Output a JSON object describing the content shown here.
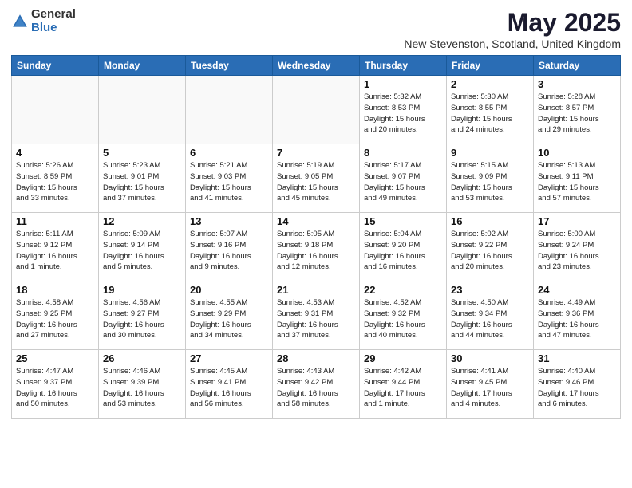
{
  "logo": {
    "general": "General",
    "blue": "Blue"
  },
  "title": "May 2025",
  "subtitle": "New Stevenston, Scotland, United Kingdom",
  "headers": [
    "Sunday",
    "Monday",
    "Tuesday",
    "Wednesday",
    "Thursday",
    "Friday",
    "Saturday"
  ],
  "weeks": [
    [
      {
        "day": "",
        "info": ""
      },
      {
        "day": "",
        "info": ""
      },
      {
        "day": "",
        "info": ""
      },
      {
        "day": "",
        "info": ""
      },
      {
        "day": "1",
        "info": "Sunrise: 5:32 AM\nSunset: 8:53 PM\nDaylight: 15 hours\nand 20 minutes."
      },
      {
        "day": "2",
        "info": "Sunrise: 5:30 AM\nSunset: 8:55 PM\nDaylight: 15 hours\nand 24 minutes."
      },
      {
        "day": "3",
        "info": "Sunrise: 5:28 AM\nSunset: 8:57 PM\nDaylight: 15 hours\nand 29 minutes."
      }
    ],
    [
      {
        "day": "4",
        "info": "Sunrise: 5:26 AM\nSunset: 8:59 PM\nDaylight: 15 hours\nand 33 minutes."
      },
      {
        "day": "5",
        "info": "Sunrise: 5:23 AM\nSunset: 9:01 PM\nDaylight: 15 hours\nand 37 minutes."
      },
      {
        "day": "6",
        "info": "Sunrise: 5:21 AM\nSunset: 9:03 PM\nDaylight: 15 hours\nand 41 minutes."
      },
      {
        "day": "7",
        "info": "Sunrise: 5:19 AM\nSunset: 9:05 PM\nDaylight: 15 hours\nand 45 minutes."
      },
      {
        "day": "8",
        "info": "Sunrise: 5:17 AM\nSunset: 9:07 PM\nDaylight: 15 hours\nand 49 minutes."
      },
      {
        "day": "9",
        "info": "Sunrise: 5:15 AM\nSunset: 9:09 PM\nDaylight: 15 hours\nand 53 minutes."
      },
      {
        "day": "10",
        "info": "Sunrise: 5:13 AM\nSunset: 9:11 PM\nDaylight: 15 hours\nand 57 minutes."
      }
    ],
    [
      {
        "day": "11",
        "info": "Sunrise: 5:11 AM\nSunset: 9:12 PM\nDaylight: 16 hours\nand 1 minute."
      },
      {
        "day": "12",
        "info": "Sunrise: 5:09 AM\nSunset: 9:14 PM\nDaylight: 16 hours\nand 5 minutes."
      },
      {
        "day": "13",
        "info": "Sunrise: 5:07 AM\nSunset: 9:16 PM\nDaylight: 16 hours\nand 9 minutes."
      },
      {
        "day": "14",
        "info": "Sunrise: 5:05 AM\nSunset: 9:18 PM\nDaylight: 16 hours\nand 12 minutes."
      },
      {
        "day": "15",
        "info": "Sunrise: 5:04 AM\nSunset: 9:20 PM\nDaylight: 16 hours\nand 16 minutes."
      },
      {
        "day": "16",
        "info": "Sunrise: 5:02 AM\nSunset: 9:22 PM\nDaylight: 16 hours\nand 20 minutes."
      },
      {
        "day": "17",
        "info": "Sunrise: 5:00 AM\nSunset: 9:24 PM\nDaylight: 16 hours\nand 23 minutes."
      }
    ],
    [
      {
        "day": "18",
        "info": "Sunrise: 4:58 AM\nSunset: 9:25 PM\nDaylight: 16 hours\nand 27 minutes."
      },
      {
        "day": "19",
        "info": "Sunrise: 4:56 AM\nSunset: 9:27 PM\nDaylight: 16 hours\nand 30 minutes."
      },
      {
        "day": "20",
        "info": "Sunrise: 4:55 AM\nSunset: 9:29 PM\nDaylight: 16 hours\nand 34 minutes."
      },
      {
        "day": "21",
        "info": "Sunrise: 4:53 AM\nSunset: 9:31 PM\nDaylight: 16 hours\nand 37 minutes."
      },
      {
        "day": "22",
        "info": "Sunrise: 4:52 AM\nSunset: 9:32 PM\nDaylight: 16 hours\nand 40 minutes."
      },
      {
        "day": "23",
        "info": "Sunrise: 4:50 AM\nSunset: 9:34 PM\nDaylight: 16 hours\nand 44 minutes."
      },
      {
        "day": "24",
        "info": "Sunrise: 4:49 AM\nSunset: 9:36 PM\nDaylight: 16 hours\nand 47 minutes."
      }
    ],
    [
      {
        "day": "25",
        "info": "Sunrise: 4:47 AM\nSunset: 9:37 PM\nDaylight: 16 hours\nand 50 minutes."
      },
      {
        "day": "26",
        "info": "Sunrise: 4:46 AM\nSunset: 9:39 PM\nDaylight: 16 hours\nand 53 minutes."
      },
      {
        "day": "27",
        "info": "Sunrise: 4:45 AM\nSunset: 9:41 PM\nDaylight: 16 hours\nand 56 minutes."
      },
      {
        "day": "28",
        "info": "Sunrise: 4:43 AM\nSunset: 9:42 PM\nDaylight: 16 hours\nand 58 minutes."
      },
      {
        "day": "29",
        "info": "Sunrise: 4:42 AM\nSunset: 9:44 PM\nDaylight: 17 hours\nand 1 minute."
      },
      {
        "day": "30",
        "info": "Sunrise: 4:41 AM\nSunset: 9:45 PM\nDaylight: 17 hours\nand 4 minutes."
      },
      {
        "day": "31",
        "info": "Sunrise: 4:40 AM\nSunset: 9:46 PM\nDaylight: 17 hours\nand 6 minutes."
      }
    ]
  ]
}
